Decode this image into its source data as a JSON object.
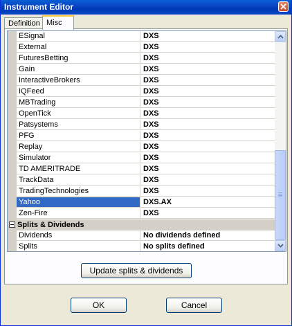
{
  "window": {
    "title": "Instrument Editor"
  },
  "tabs": [
    {
      "label": "Definition",
      "active": false
    },
    {
      "label": "Misc",
      "active": true
    }
  ],
  "grid": {
    "rows": [
      {
        "name": "ESignal",
        "value": "DXS"
      },
      {
        "name": "External",
        "value": "DXS"
      },
      {
        "name": "FuturesBetting",
        "value": "DXS"
      },
      {
        "name": "Gain",
        "value": "DXS"
      },
      {
        "name": "InteractiveBrokers",
        "value": "DXS"
      },
      {
        "name": "IQFeed",
        "value": "DXS"
      },
      {
        "name": "MBTrading",
        "value": "DXS"
      },
      {
        "name": "OpenTick",
        "value": "DXS"
      },
      {
        "name": "Patsystems",
        "value": "DXS"
      },
      {
        "name": "PFG",
        "value": "DXS"
      },
      {
        "name": "Replay",
        "value": "DXS"
      },
      {
        "name": "Simulator",
        "value": "DXS"
      },
      {
        "name": "TD AMERITRADE",
        "value": "DXS"
      },
      {
        "name": "TrackData",
        "value": "DXS"
      },
      {
        "name": "TradingTechnologies",
        "value": "DXS"
      },
      {
        "name": "Yahoo",
        "value": "DXS.AX",
        "selected": true
      },
      {
        "name": "Zen-Fire",
        "value": "DXS"
      }
    ],
    "category": {
      "label": "Splits & Dividends",
      "expanded": true
    },
    "category_rows": [
      {
        "name": "Dividends",
        "value": "No dividends defined"
      },
      {
        "name": "Splits",
        "value": "No splits defined"
      }
    ]
  },
  "buttons": {
    "update": "Update splits & dividends",
    "ok": "OK",
    "cancel": "Cancel"
  },
  "colors": {
    "selection": "#316ac5",
    "titlebar": "#0843c2",
    "dialog_bg": "#ece9d8"
  },
  "icons": [
    "close-icon",
    "scroll-up-icon",
    "scroll-down-icon",
    "collapse-icon"
  ]
}
